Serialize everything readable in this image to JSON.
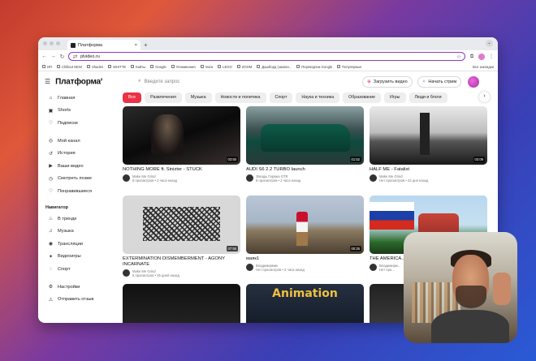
{
  "browser": {
    "tab_title": "Платформа",
    "new_tab": "+",
    "url": "plvideo.ru",
    "bookmarks": [
      "ИП",
      "Chillout NEW",
      "Shades",
      "WHITTE",
      "Кайты",
      "Google",
      "Упоминания",
      "mara",
      "LEGO",
      "ZOOM",
      "Дашборд (захвач...",
      "Переводчик Google",
      "Популярные"
    ],
    "all_bookmarks": "Все закладки"
  },
  "header": {
    "logo": "Платформа",
    "logo_sup": "β",
    "search_placeholder": "Введите запрос",
    "upload_button": "Загрузить видео",
    "stream_button": "Начать стрим"
  },
  "sidebar": {
    "items_top": [
      {
        "label": "Главная",
        "icon": "home-icon"
      },
      {
        "label": "Shorts",
        "icon": "shorts-icon"
      },
      {
        "label": "Подписки",
        "icon": "heart-icon"
      }
    ],
    "items_you": [
      {
        "label": "Мой канал",
        "icon": "user-icon"
      },
      {
        "label": "История",
        "icon": "history-icon"
      },
      {
        "label": "Ваши видео",
        "icon": "video-icon"
      },
      {
        "label": "Смотреть позже",
        "icon": "clock-icon"
      },
      {
        "label": "Понравившиеся",
        "icon": "like-icon"
      }
    ],
    "navigator_heading": "Навигатор",
    "items_nav": [
      {
        "label": "В тренде",
        "icon": "flame-icon"
      },
      {
        "label": "Музыка",
        "icon": "music-icon"
      },
      {
        "label": "Трансляции",
        "icon": "broadcast-icon"
      },
      {
        "label": "Видеоигры",
        "icon": "gamepad-icon"
      },
      {
        "label": "Спорт",
        "icon": "sport-icon"
      }
    ],
    "items_bottom": [
      {
        "label": "Настройки",
        "icon": "gear-icon"
      },
      {
        "label": "Отправить отзыв",
        "icon": "feedback-icon"
      }
    ]
  },
  "chips": [
    "Все",
    "Развлечения",
    "Музыка",
    "Новости и политика",
    "Спорт",
    "Наука и техника",
    "Образование",
    "Игры",
    "Люди и блоги"
  ],
  "videos": [
    {
      "title": "NOTHING MORE ft. Sinizter - STUCK",
      "channel": "Make Me Grind",
      "stats": "8 просмотров • 2 часа назад",
      "duration": "03:50"
    },
    {
      "title": "AUDI S6 2.2 TURBO launch",
      "channel": "Звезды Гаража GTR",
      "stats": "8 просмотров • 2 часа назад",
      "duration": "01:52"
    },
    {
      "title": "HALF ME - Fatalist",
      "channel": "Make Me Grind",
      "stats": "Нет просмотров • 22 дня назад",
      "duration": "03:09"
    },
    {
      "title": "EXTERMINATION DISMEMBERMENT - AGONY INCARNATE",
      "channel": "Make Me Grind",
      "stats": "5 просмотров • 25 дней назад",
      "duration": "07:55"
    },
    {
      "title": "маяк1",
      "channel": "Владимирмик",
      "stats": "Нет просмотров • 2 часа назад",
      "duration": "00:25"
    },
    {
      "title": "THE AMERICA... RUSSIANS",
      "channel": "Владимирм...",
      "stats": "Нет про...",
      "duration": ""
    },
    {
      "title": "",
      "channel": "",
      "stats": "",
      "duration": ""
    },
    {
      "title": "",
      "channel": "",
      "stats": "",
      "duration": ""
    },
    {
      "title": "",
      "channel": "",
      "stats": "",
      "duration": ""
    }
  ],
  "animation_text": "Animation"
}
